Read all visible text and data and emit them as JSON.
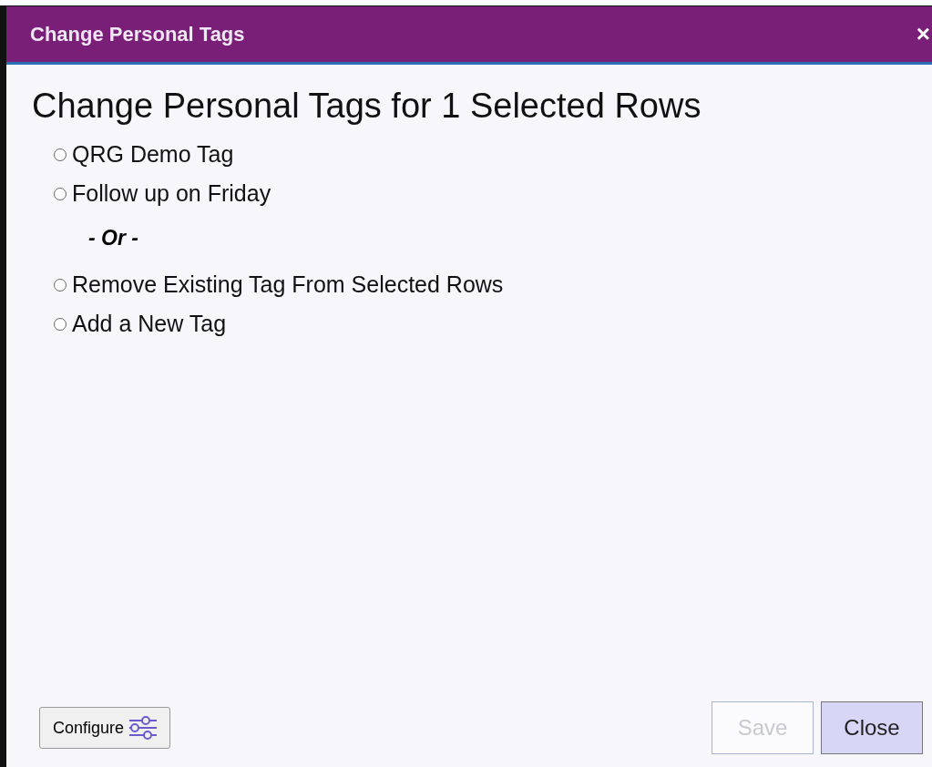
{
  "window": {
    "title": "Change Personal Tags",
    "close": "×"
  },
  "heading": "Change Personal Tags for 1 Selected Rows",
  "options": [
    {
      "label": "QRG Demo Tag",
      "selected": false
    },
    {
      "label": "Follow up on Friday",
      "selected": false
    }
  ],
  "separator": "- Or -",
  "actions": [
    {
      "label": "Remove Existing Tag From Selected Rows",
      "selected": false
    },
    {
      "label": "Add a New Tag",
      "selected": false
    }
  ],
  "buttons": {
    "configure": "Configure",
    "save": {
      "label": "Save",
      "disabled": true
    },
    "close": {
      "label": "Close",
      "disabled": false
    }
  }
}
